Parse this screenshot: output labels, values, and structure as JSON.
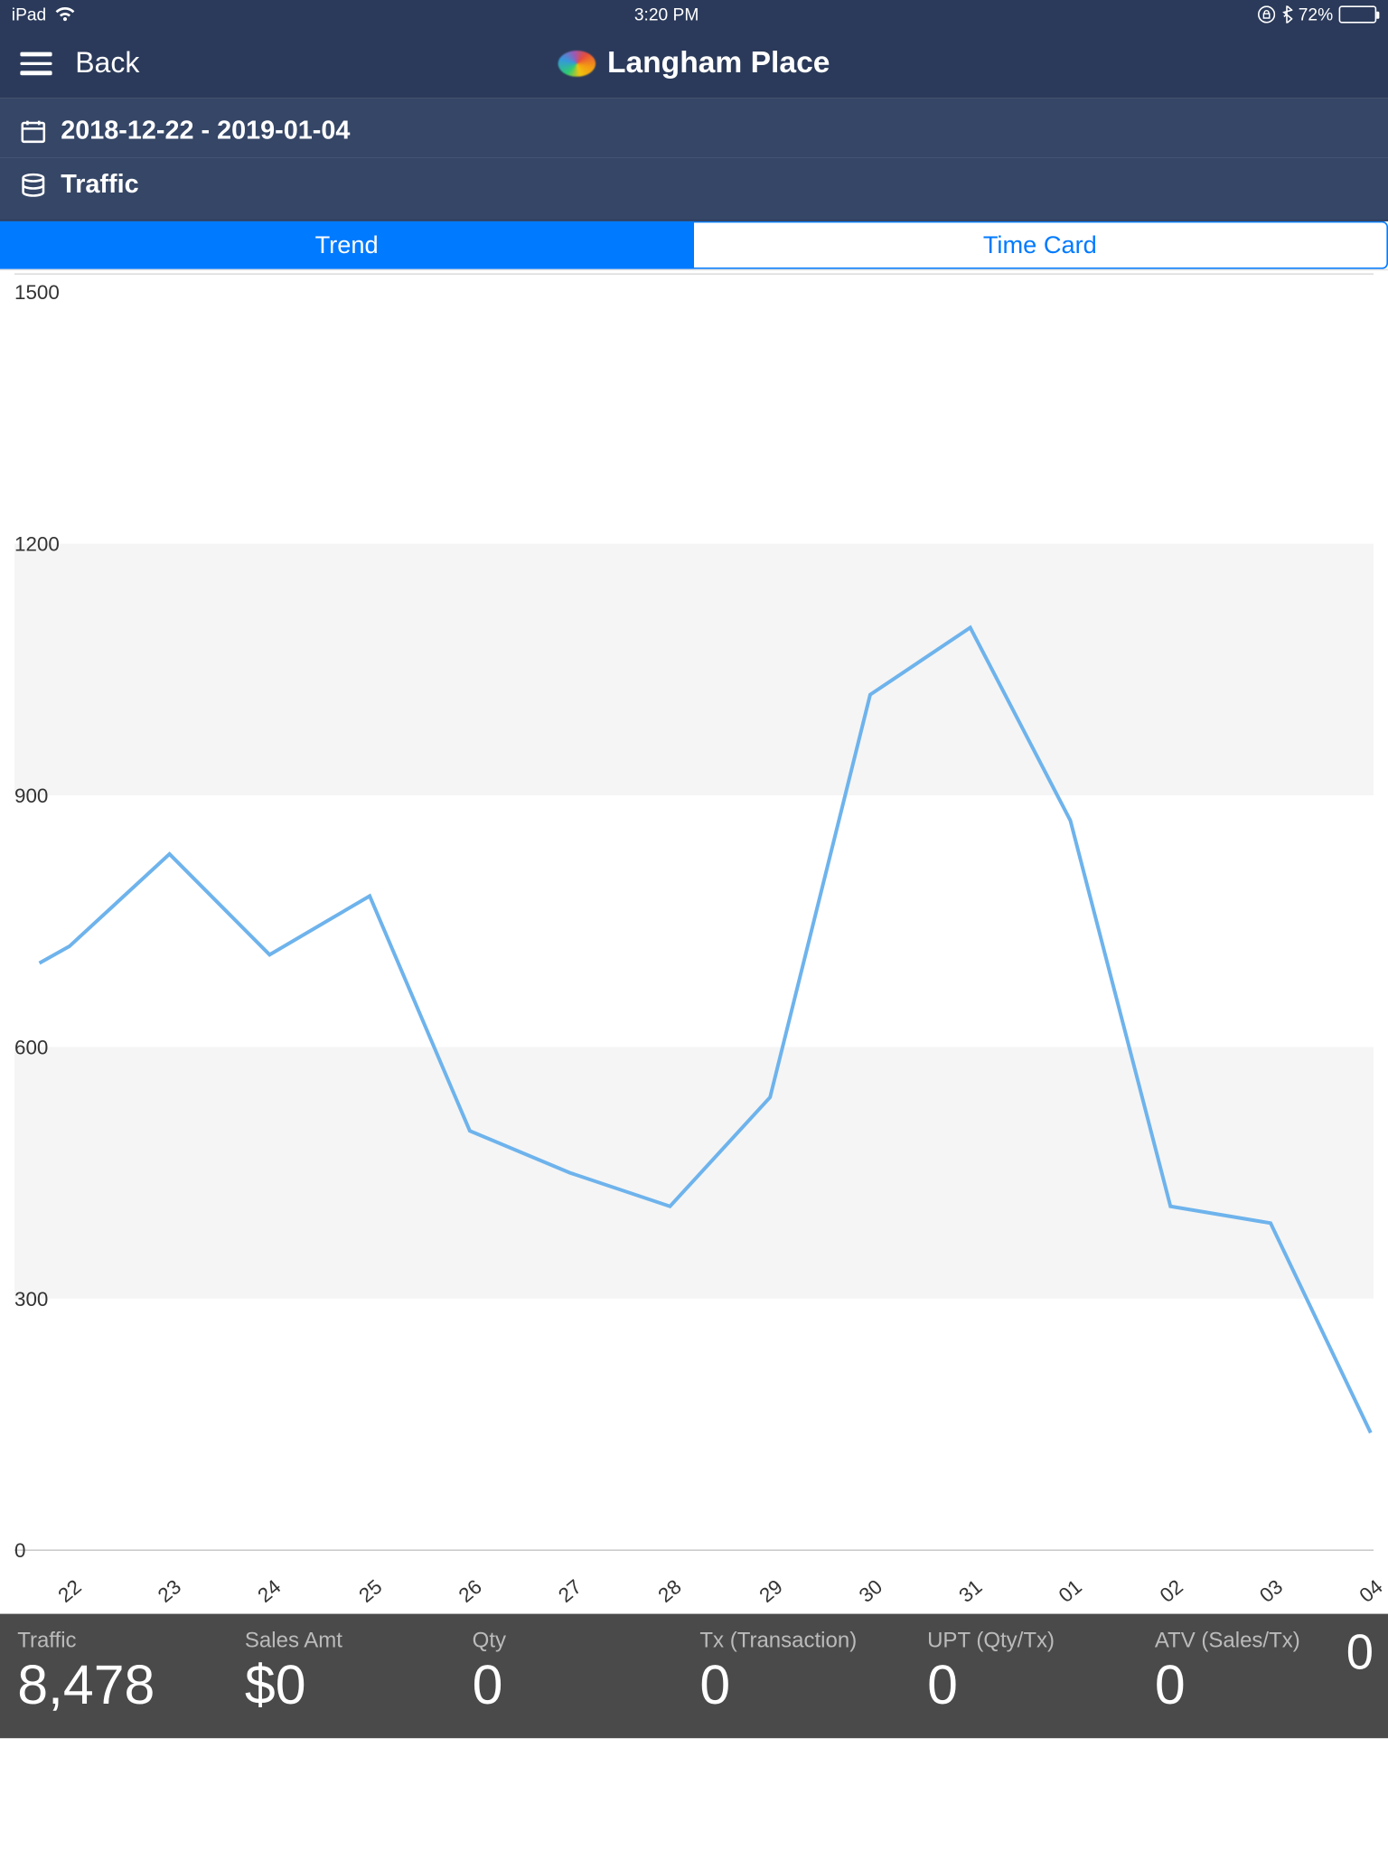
{
  "status_bar": {
    "device": "iPad",
    "time": "3:20 PM",
    "battery_pct": "72%"
  },
  "nav": {
    "back_label": "Back",
    "title": "Langham Place"
  },
  "header": {
    "date_range": "2018-12-22 - 2019-01-04",
    "section": "Traffic"
  },
  "tabs": {
    "trend": "Trend",
    "timecard": "Time Card"
  },
  "chart_data": {
    "type": "line",
    "title": "",
    "xlabel": "",
    "ylabel": "",
    "ylim": [
      0,
      1500
    ],
    "yticks": [
      0,
      300,
      600,
      900,
      1200,
      1500
    ],
    "categories": [
      "22",
      "23",
      "24",
      "25",
      "26",
      "27",
      "28",
      "29",
      "30",
      "31",
      "01",
      "02",
      "03",
      "04"
    ],
    "values": [
      720,
      830,
      710,
      780,
      500,
      450,
      410,
      540,
      1020,
      1100,
      870,
      410,
      390,
      140
    ]
  },
  "stats": {
    "traffic_label": "Traffic",
    "traffic_value": "8,478",
    "sales_label": "Sales Amt",
    "sales_value": "$0",
    "qty_label": "Qty",
    "qty_value": "0",
    "tx_label": "Tx (Transaction)",
    "tx_value": "0",
    "upt_label": "UPT (Qty/Tx)",
    "upt_value": "0",
    "atv_label": "ATV (Sales/Tx)",
    "atv_value": "0",
    "trailing": "0"
  }
}
